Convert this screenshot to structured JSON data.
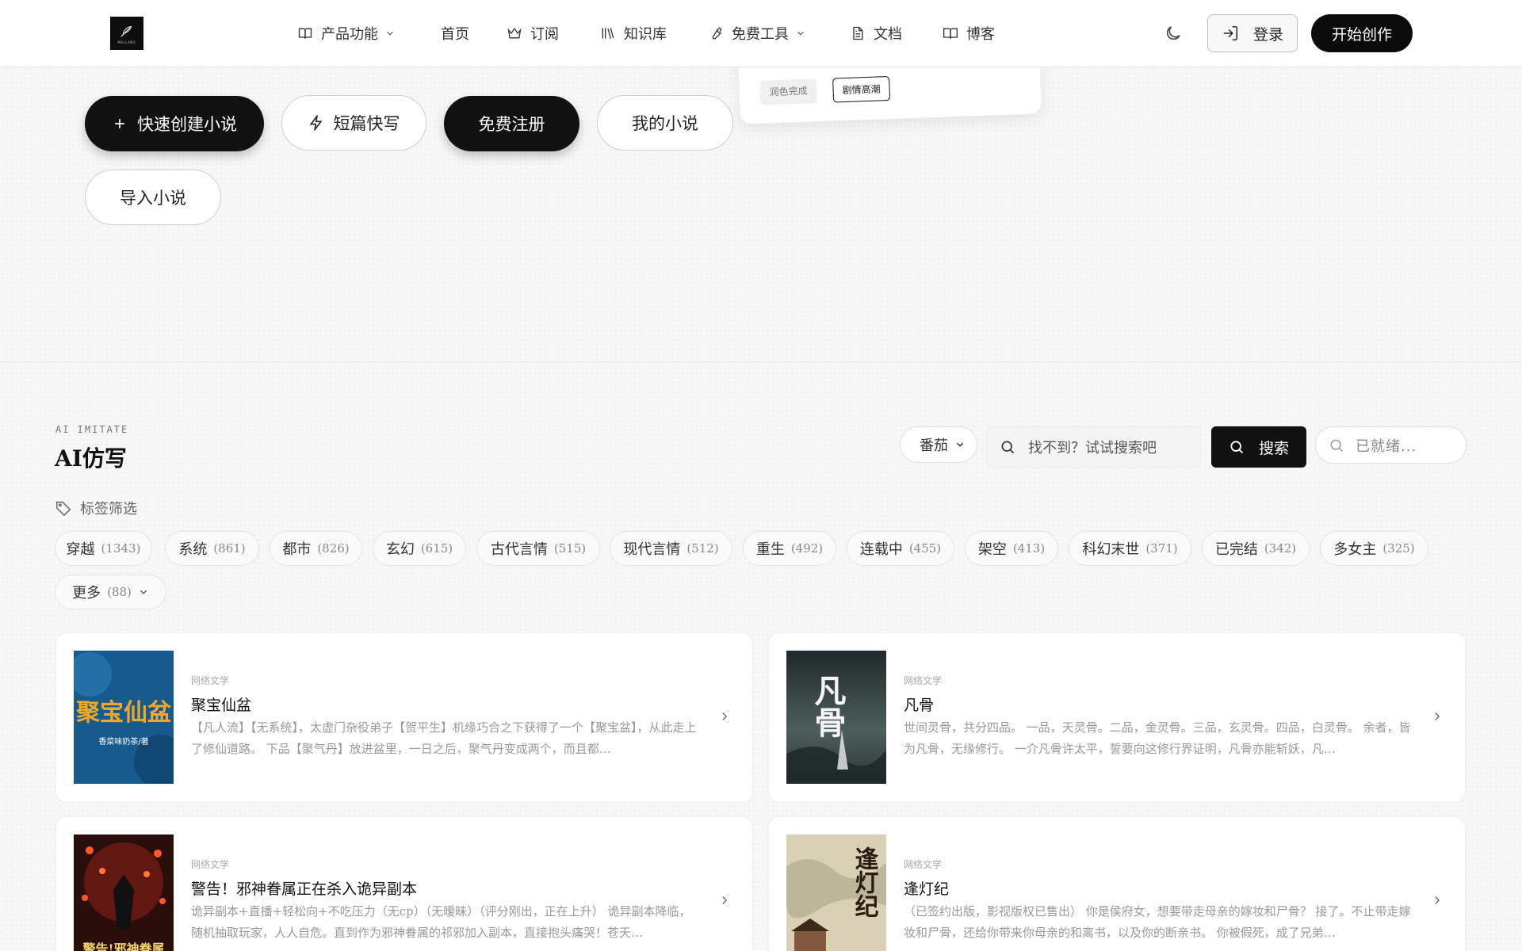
{
  "header": {
    "logo_text": "MALLANG",
    "nav": [
      {
        "label": "产品功能",
        "icon": "book-icon",
        "dropdown": true
      },
      {
        "label": "首页",
        "icon": "",
        "dropdown": false
      },
      {
        "label": "订阅",
        "icon": "crown-icon",
        "dropdown": false
      },
      {
        "label": "知识库",
        "icon": "library-icon",
        "dropdown": false
      },
      {
        "label": "免费工具",
        "icon": "wrench-icon",
        "dropdown": true
      },
      {
        "label": "文档",
        "icon": "file-text-icon",
        "dropdown": false
      },
      {
        "label": "博客",
        "icon": "book-open-icon",
        "dropdown": false
      }
    ],
    "login_label": "登录",
    "start_label": "开始创作"
  },
  "float_card": {
    "tag_a": "润色完成",
    "tag_b": "剧情高潮"
  },
  "hero_buttons": {
    "quick_create": "快速创建小说",
    "short_story": "短篇快写",
    "register": "免费注册",
    "my_novels": "我的小说",
    "import": "导入小说"
  },
  "section": {
    "kicker": "AI IMITATE",
    "title": "AI仿写",
    "source_select": "番茄",
    "search_placeholder": "找不到？试试搜索吧",
    "search_button": "搜索",
    "status": "已就绪...",
    "tag_filter_label": "标签筛选"
  },
  "tags": [
    {
      "label": "穿越",
      "count": "(1343)"
    },
    {
      "label": "系统",
      "count": "(861)"
    },
    {
      "label": "都市",
      "count": "(826)"
    },
    {
      "label": "玄幻",
      "count": "(615)"
    },
    {
      "label": "古代言情",
      "count": "(515)"
    },
    {
      "label": "现代言情",
      "count": "(512)"
    },
    {
      "label": "重生",
      "count": "(492)"
    },
    {
      "label": "连载中",
      "count": "(455)"
    },
    {
      "label": "架空",
      "count": "(413)"
    },
    {
      "label": "科幻末世",
      "count": "(371)"
    },
    {
      "label": "已完结",
      "count": "(342)"
    },
    {
      "label": "多女主",
      "count": "(325)"
    },
    {
      "label": "更多",
      "count": "(88)"
    }
  ],
  "novels": [
    {
      "category": "网络文学",
      "title": "聚宝仙盆",
      "cover_title": "聚宝仙盆",
      "cover_author": "香菜味奶茶/著",
      "desc": "【凡人流】【无系统】，太虚门杂役弟子【贺平生】机缘巧合之下获得了一个【聚宝盆】，从此走上了修仙道路。 下品【聚气丹】放进盆里，一日之后，聚气丹变成两个，而且都…",
      "colors": {
        "cover_bg": "#1f6fa6",
        "cover_text": "#f0a020"
      }
    },
    {
      "category": "网络文学",
      "title": "凡骨",
      "cover_title": "凡骨",
      "cover_author": "",
      "desc": "世间灵骨，共分四品。 一品，天灵骨。二品，金灵骨。三品，玄灵骨。四品，白灵骨。 余者，皆为凡骨，无缘修行。 一介凡骨许太平，誓要向这修行界证明，凡骨亦能斩妖，凡…",
      "colors": {
        "cover_bg": "#2e3d3f",
        "cover_text": "#f2f2f2"
      }
    },
    {
      "category": "网络文学",
      "title": "警告！邪神眷属正在杀入诡异副本",
      "cover_title": "警告!邪神眷属",
      "cover_author": "",
      "desc": "诡异副本+直播+轻松向+不吃压力（无cp）（无暧昧）（评分刚出，正在上升） 诡异副本降临，随机抽取玩家，人人自危。直到作为邪神眷属的祁邪加入副本，直接抱头痛哭！苍天…",
      "colors": {
        "cover_bg": "#3a1410",
        "cover_text": "#f5d76e"
      }
    },
    {
      "category": "网络文学",
      "title": "逢灯纪",
      "cover_title": "逢灯纪",
      "cover_author": "",
      "desc": "（已签约出版，影视版权已售出） 你是侯府女，想要带走母亲的嫁妆和尸骨？ 接了。不止带走嫁妆和尸骨，还给你带来你母亲的和离书，以及你的断亲书。 你被假死，成了兄弟…",
      "colors": {
        "cover_bg": "#d8cfb8",
        "cover_text": "#3a2a1a"
      }
    }
  ]
}
